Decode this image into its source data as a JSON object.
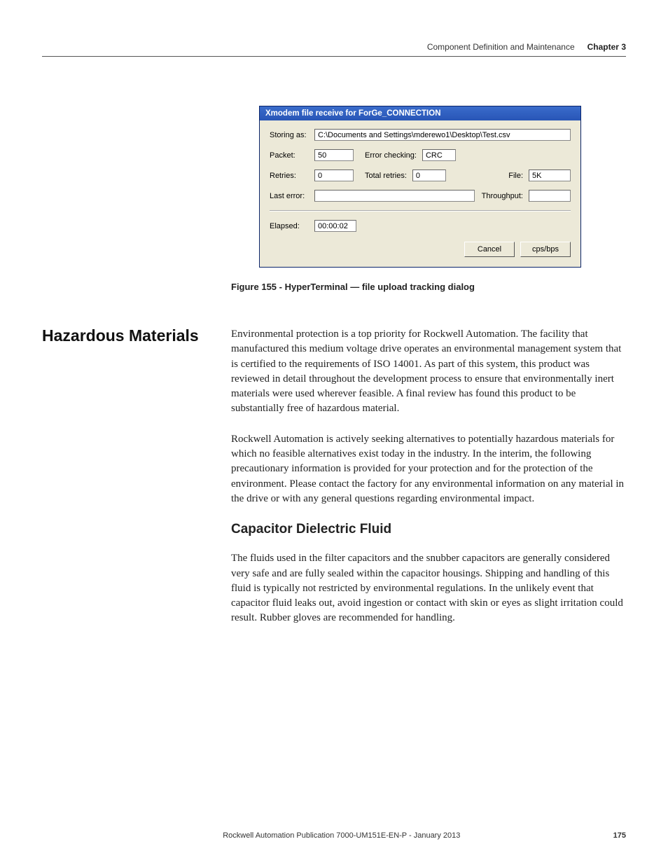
{
  "header": {
    "breadcrumb": "Component Definition and Maintenance",
    "chapter": "Chapter 3"
  },
  "dialog": {
    "title": "Xmodem file receive for ForGe_CONNECTION",
    "storing_as_label": "Storing as:",
    "storing_as_value": "C:\\Documents and Settings\\mderewo1\\Desktop\\Test.csv",
    "packet_label": "Packet:",
    "packet_value": "50",
    "error_checking_label": "Error checking:",
    "error_checking_value": "CRC",
    "retries_label": "Retries:",
    "retries_value": "0",
    "total_retries_label": "Total retries:",
    "total_retries_value": "0",
    "file_label": "File:",
    "file_value": "5K",
    "last_error_label": "Last error:",
    "last_error_value": "",
    "throughput_label": "Throughput:",
    "throughput_value": "",
    "elapsed_label": "Elapsed:",
    "elapsed_value": "00:00:02",
    "cancel_button": "Cancel",
    "cpsbps_button": "cps/bps"
  },
  "figure_caption": "Figure 155 - HyperTerminal — file upload tracking dialog",
  "section": {
    "sidehead": "Hazardous Materials",
    "para1": "Environmental protection is a top priority for Rockwell Automation. The facility that manufactured this medium voltage drive operates an environmental management system that is certified to the requirements of ISO 14001. As part of this system, this product was reviewed in detail throughout the development process to ensure that environmentally inert materials were used wherever feasible. A final review has found this product to be substantially free of hazardous material.",
    "para2": "Rockwell Automation is actively seeking alternatives to potentially hazardous materials for which no feasible alternatives exist today in the industry. In the interim, the following precautionary information is provided for your protection and for the protection of the environment. Please contact the factory for any environmental information on any material in the drive or with any general questions regarding environmental impact.",
    "subhead": "Capacitor Dielectric Fluid",
    "para3": "The fluids used in the filter capacitors and the snubber capacitors are generally considered very safe and are fully sealed within the capacitor housings. Shipping and handling of this fluid is typically not restricted by environmental regulations. In the unlikely event that capacitor fluid leaks out, avoid ingestion or contact with skin or eyes as slight irritation could result. Rubber gloves are recommended for handling."
  },
  "footer": {
    "publication": "Rockwell Automation Publication 7000-UM151E-EN-P - January 2013",
    "page": "175"
  }
}
